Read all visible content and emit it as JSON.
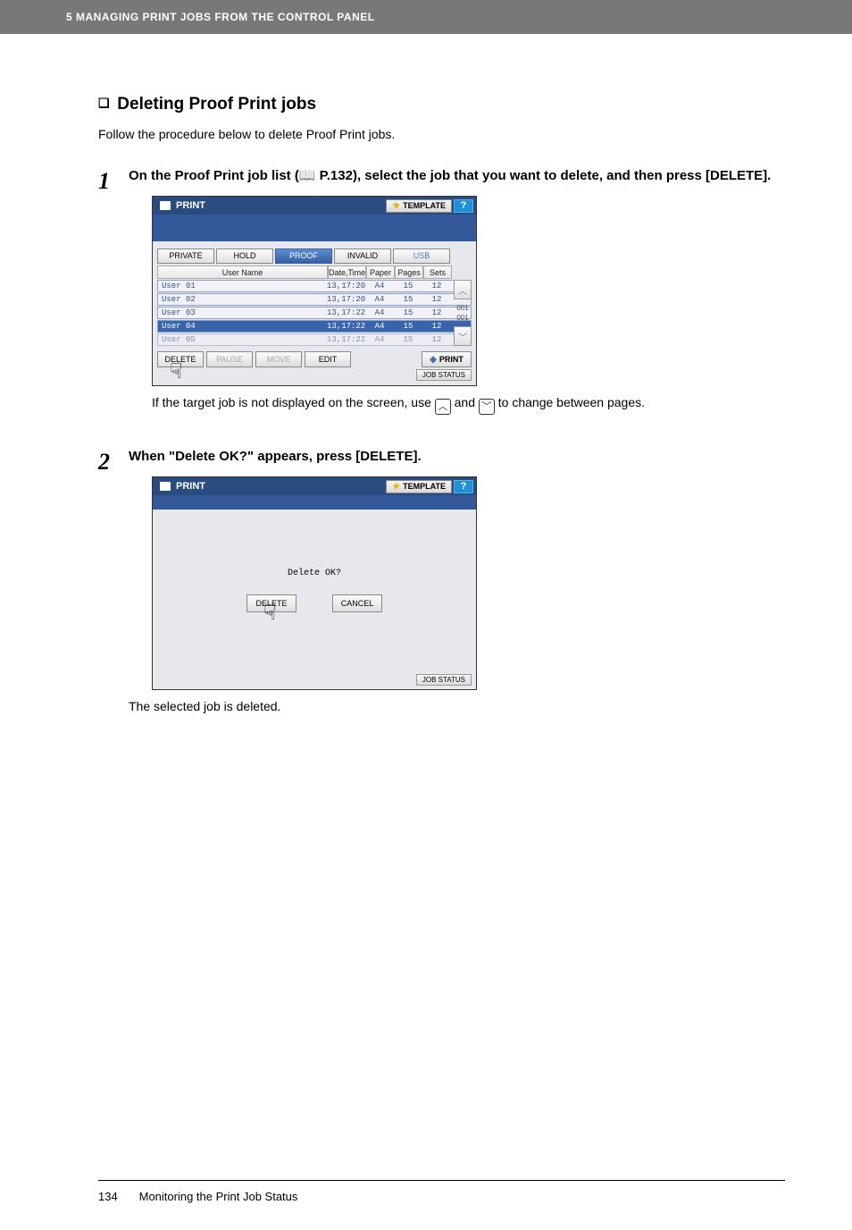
{
  "header": {
    "text": "5 MANAGING PRINT JOBS FROM THE CONTROL PANEL"
  },
  "section": {
    "title": "Deleting Proof Print jobs"
  },
  "intro": "Follow the procedure below to delete Proof Print jobs.",
  "steps": {
    "s1": {
      "num": "1",
      "head_a": "On the Proof Print job list (",
      "head_ref": " P.132",
      "head_b": "), select the job that you want to delete, and then press [DELETE]."
    },
    "s2": {
      "num": "2",
      "head": "When \"Delete OK?\" appears, press [DELETE]."
    }
  },
  "panel1": {
    "title": "PRINT",
    "template": "TEMPLATE",
    "help": "?",
    "tabs": {
      "private": "PRIVATE",
      "hold": "HOLD",
      "proof": "PROOF",
      "invalid": "INVALID",
      "usb": "USB"
    },
    "cols": {
      "user": "User Name",
      "date": "Date,Time",
      "paper": "Paper",
      "pages": "Pages",
      "sets": "Sets"
    },
    "rows": [
      {
        "user": "User 01",
        "date": "13,17:20",
        "paper": "A4",
        "pages": "15",
        "sets": "12"
      },
      {
        "user": "User 02",
        "date": "13,17:20",
        "paper": "A4",
        "pages": "15",
        "sets": "12"
      },
      {
        "user": "User 03",
        "date": "13,17:22",
        "paper": "A4",
        "pages": "15",
        "sets": "12"
      },
      {
        "user": "User 04",
        "date": "13,17:22",
        "paper": "A4",
        "pages": "15",
        "sets": "12"
      },
      {
        "user": "User 05",
        "date": "13,17:22",
        "paper": "A4",
        "pages": "15",
        "sets": "12"
      }
    ],
    "scroll": {
      "p1": "001",
      "p2": "001"
    },
    "actions": {
      "delete": "DELETE",
      "pause": "PAUSE",
      "move": "MOVE",
      "edit": "EDIT",
      "print": "PRINT"
    },
    "jobstatus": "JOB STATUS"
  },
  "note1": {
    "a": "If the target job is not displayed on the screen, use ",
    "b": " and ",
    "c": " to change between pages."
  },
  "panel2": {
    "title": "PRINT",
    "template": "TEMPLATE",
    "help": "?",
    "confirm": "Delete OK?",
    "delete": "DELETE",
    "cancel": "CANCEL",
    "jobstatus": "JOB STATUS"
  },
  "after2": "The selected job is deleted.",
  "footer": {
    "page": "134",
    "title": "Monitoring the Print Job Status"
  }
}
